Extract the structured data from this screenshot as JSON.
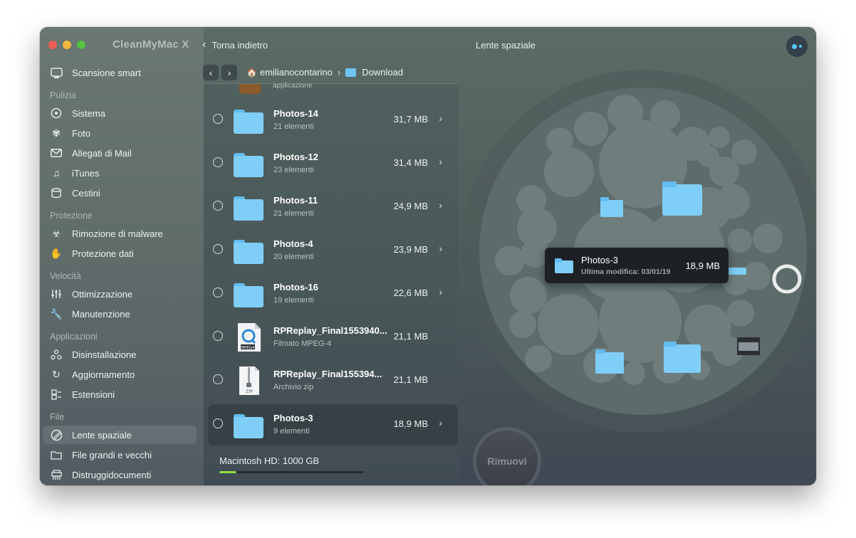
{
  "app": {
    "title": "CleanMyMac X"
  },
  "header": {
    "back_label": "Torna indietro",
    "title": "Lente spaziale"
  },
  "breadcrumb": {
    "user": "emilianocontarino",
    "folder": "Download"
  },
  "sidebar": {
    "smart_scan": "Scansione smart",
    "sections": [
      {
        "title": "Pulizia",
        "items": [
          "Sistema",
          "Foto",
          "Allegati di Mail",
          "iTunes",
          "Cestini"
        ]
      },
      {
        "title": "Protezione",
        "items": [
          "Rimozione di malware",
          "Protezione dati"
        ]
      },
      {
        "title": "Velocità",
        "items": [
          "Ottimizzazione",
          "Manutenzione"
        ]
      },
      {
        "title": "Applicazioni",
        "items": [
          "Disinstallazione",
          "Aggiornamento",
          "Estensioni"
        ]
      },
      {
        "title": "File",
        "items": [
          "Lente spaziale",
          "File grandi e vecchi",
          "Distruggidocumenti"
        ]
      }
    ],
    "active_item": "Lente spaziale"
  },
  "list": {
    "partial_row_sub": "applicazione",
    "rows": [
      {
        "name": "Photos-14",
        "sub": "21 elementi",
        "size": "31,7 MB",
        "kind": "folder"
      },
      {
        "name": "Photos-12",
        "sub": "23 elementi",
        "size": "31,4 MB",
        "kind": "folder"
      },
      {
        "name": "Photos-11",
        "sub": "21 elementi",
        "size": "24,9 MB",
        "kind": "folder"
      },
      {
        "name": "Photos-4",
        "sub": "20 elementi",
        "size": "23,9 MB",
        "kind": "folder"
      },
      {
        "name": "Photos-16",
        "sub": "19 elementi",
        "size": "22,6 MB",
        "kind": "folder"
      },
      {
        "name": "RPReplay_Final1553940...",
        "sub": "Filmato MPEG-4",
        "size": "21,1 MB",
        "kind": "video",
        "badge": "MPEG4"
      },
      {
        "name": "RPReplay_Final155394...",
        "sub": "Archivio zip",
        "size": "21,1 MB",
        "kind": "zip",
        "badge": "ZIP"
      },
      {
        "name": "Photos-3",
        "sub": "9 elementi",
        "size": "18,9 MB",
        "kind": "folder",
        "selected": true
      }
    ]
  },
  "disk": {
    "label": "Macintosh HD: 1000 GB",
    "used_fraction": 0.12
  },
  "remove_button": "Rimuovi",
  "tooltip": {
    "name": "Photos-3",
    "sub": "Ultima modifica: 03/01/19",
    "size": "18,9 MB"
  },
  "colors": {
    "folder": "#7fcef7",
    "accent_green": "#8fdc3c",
    "assistant": "#5ac8f5"
  },
  "icons": {
    "sidebar": [
      "target-icon",
      "disc-icon",
      "flower-icon",
      "mail-icon",
      "music-note-icon",
      "trash-bins-icon",
      "biohazard-icon",
      "hand-icon",
      "sliders-icon",
      "wrench-icon",
      "apps-icon",
      "update-arrows-icon",
      "extensions-icon",
      "space-lens-icon",
      "folder-icon",
      "shredder-icon"
    ]
  }
}
